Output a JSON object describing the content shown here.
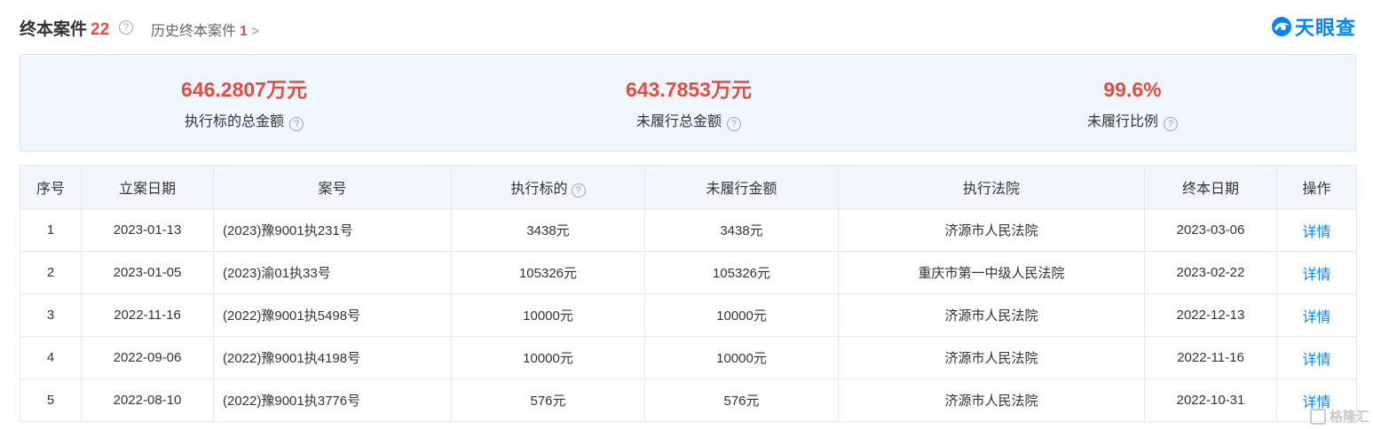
{
  "header": {
    "title": "终本案件",
    "count": "22",
    "help_glyph": "?",
    "history_label": "历史终本案件",
    "history_count": "1",
    "history_chevron": ">",
    "logo_text": "天眼查",
    "logo_color": "#0084ff"
  },
  "summary": [
    {
      "value": "646.2807万元",
      "label": "执行标的总金额",
      "help": "?"
    },
    {
      "value": "643.7853万元",
      "label": "未履行总金额",
      "help": "?"
    },
    {
      "value": "99.6%",
      "label": "未履行比例",
      "help": "?"
    }
  ],
  "table": {
    "columns": [
      "序号",
      "立案日期",
      "案号",
      "执行标的",
      "未履行金额",
      "执行法院",
      "终本日期",
      "操作"
    ],
    "column_help": "?",
    "rows": [
      {
        "no": "1",
        "filing_date": "2023-01-13",
        "case_no": "(2023)豫9001执231号",
        "subject": "3438元",
        "unpaid": "3438元",
        "court": "济源市人民法院",
        "end_date": "2023-03-06",
        "action": "详情"
      },
      {
        "no": "2",
        "filing_date": "2023-01-05",
        "case_no": "(2023)渝01执33号",
        "subject": "105326元",
        "unpaid": "105326元",
        "court": "重庆市第一中级人民法院",
        "end_date": "2023-02-22",
        "action": "详情"
      },
      {
        "no": "3",
        "filing_date": "2022-11-16",
        "case_no": "(2022)豫9001执5498号",
        "subject": "10000元",
        "unpaid": "10000元",
        "court": "济源市人民法院",
        "end_date": "2022-12-13",
        "action": "详情"
      },
      {
        "no": "4",
        "filing_date": "2022-09-06",
        "case_no": "(2022)豫9001执4198号",
        "subject": "10000元",
        "unpaid": "10000元",
        "court": "济源市人民法院",
        "end_date": "2022-11-16",
        "action": "详情"
      },
      {
        "no": "5",
        "filing_date": "2022-08-10",
        "case_no": "(2022)豫9001执3776号",
        "subject": "576元",
        "unpaid": "576元",
        "court": "济源市人民法院",
        "end_date": "2022-10-31",
        "action": "详情"
      }
    ]
  },
  "watermark": {
    "text": "格隆汇"
  },
  "colors": {
    "accent_red": "#e94a3f",
    "link_blue": "#0084ff",
    "summary_bg": "#f0f6fd",
    "header_bg": "#f3f7fc"
  }
}
